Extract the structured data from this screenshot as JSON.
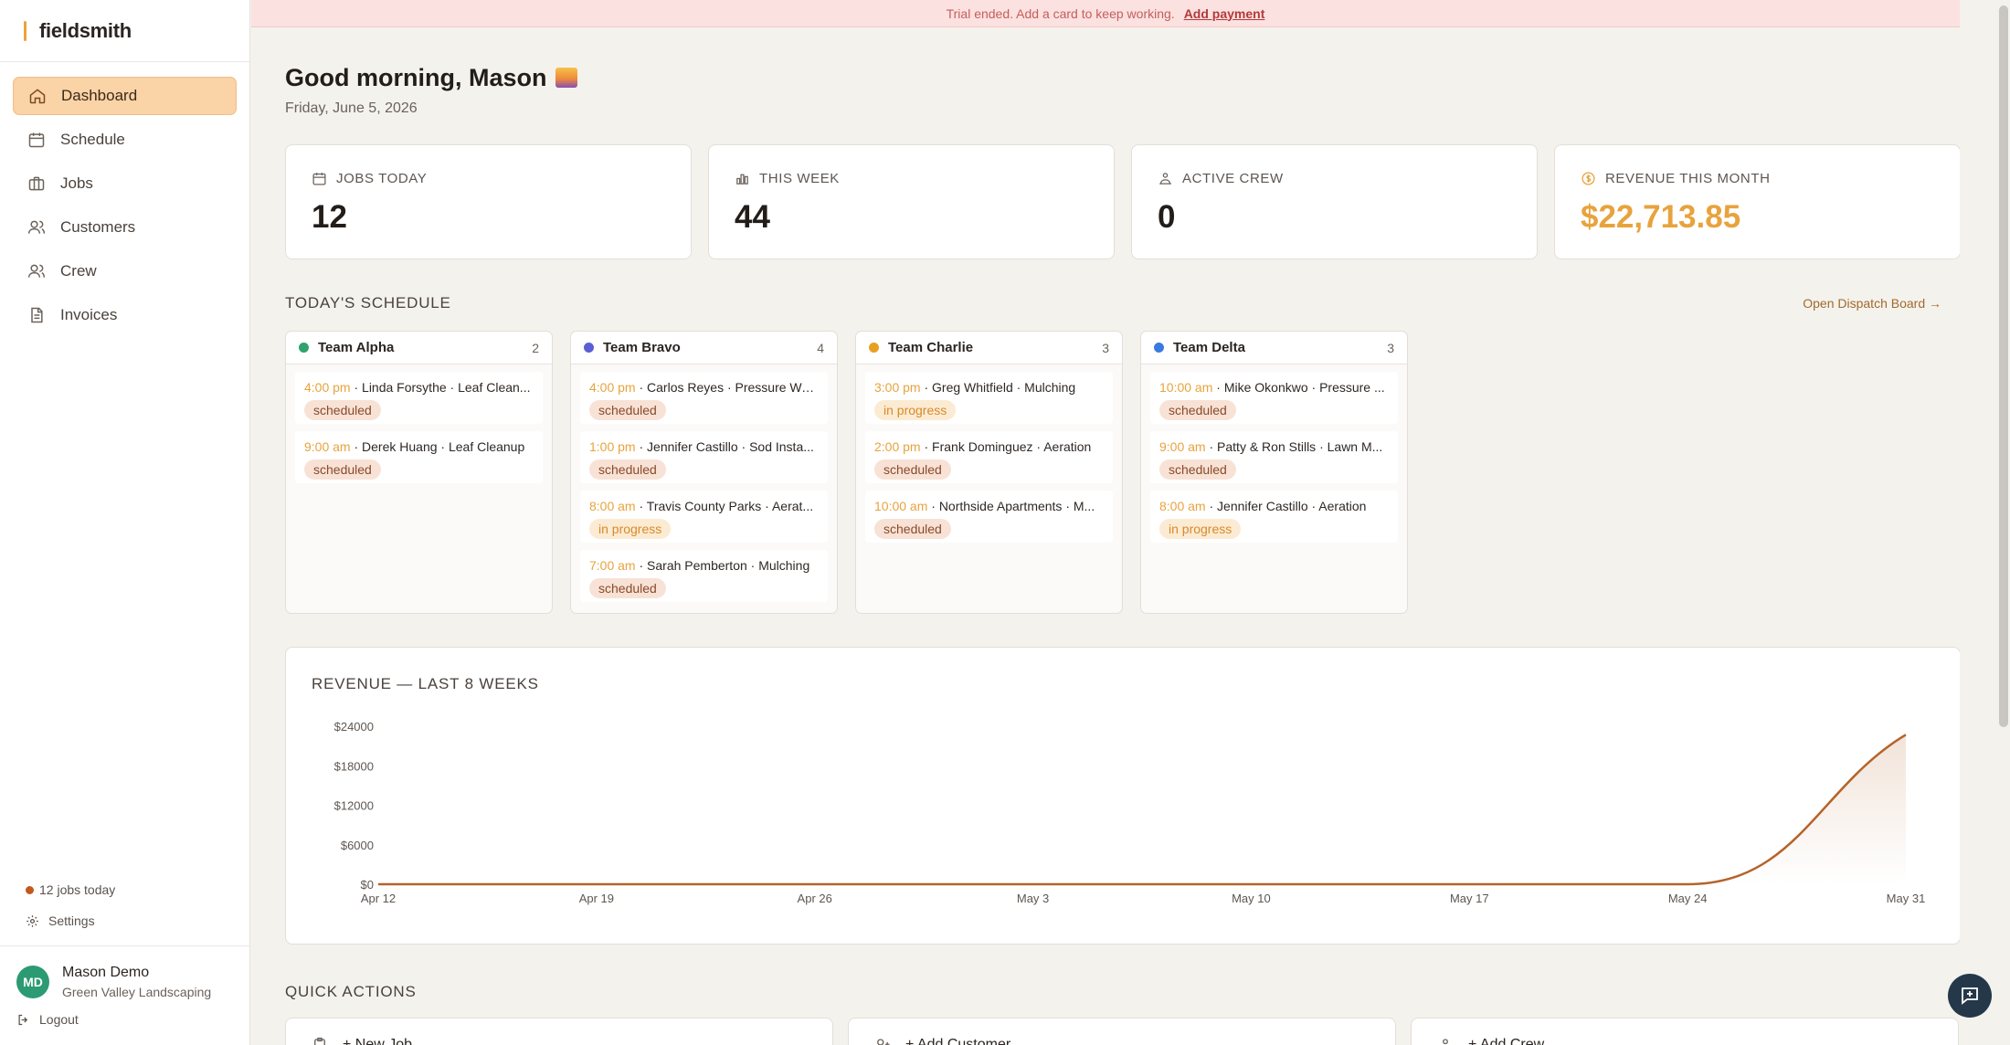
{
  "app": {
    "name": "fieldsmith"
  },
  "banner": {
    "text": "Trial ended. Add a card to keep working.",
    "link": "Add payment"
  },
  "sidebar": {
    "items": [
      {
        "label": "Dashboard",
        "icon": "home-icon",
        "active": true
      },
      {
        "label": "Schedule",
        "icon": "calendar-icon"
      },
      {
        "label": "Jobs",
        "icon": "briefcase-icon"
      },
      {
        "label": "Customers",
        "icon": "users-icon"
      },
      {
        "label": "Crew",
        "icon": "users-icon"
      },
      {
        "label": "Invoices",
        "icon": "document-icon"
      }
    ],
    "status": "12 jobs today",
    "settings": "Settings",
    "user": {
      "initials": "MD",
      "name": "Mason Demo",
      "company": "Green Valley Landscaping"
    },
    "logout": "Logout"
  },
  "header": {
    "greeting": "Good morning, Mason",
    "date": "Friday, June 5, 2026"
  },
  "stats": [
    {
      "label": "JOBS TODAY",
      "value": "12",
      "icon": "calendar-icon"
    },
    {
      "label": "THIS WEEK",
      "value": "44",
      "icon": "bar-chart-icon"
    },
    {
      "label": "ACTIVE CREW",
      "value": "0",
      "icon": "crew-icon"
    },
    {
      "label": "REVENUE THIS MONTH",
      "value": "$22,713.85",
      "icon": "dollar-icon"
    }
  ],
  "schedule": {
    "title": "TODAY'S SCHEDULE",
    "link": "Open Dispatch Board →",
    "teams": [
      {
        "name": "Team Alpha",
        "count": "2",
        "color": "#2fa36b",
        "jobs": [
          {
            "time": "4:00 pm",
            "text": " · Linda Forsythe · Leaf Clean...",
            "status": "scheduled"
          },
          {
            "time": "9:00 am",
            "text": " · Derek Huang · Leaf Cleanup",
            "status": "scheduled"
          }
        ]
      },
      {
        "name": "Team Bravo",
        "count": "4",
        "color": "#5a5fd6",
        "jobs": [
          {
            "time": "4:00 pm",
            "text": " · Carlos Reyes · Pressure Wa...",
            "status": "scheduled"
          },
          {
            "time": "1:00 pm",
            "text": " · Jennifer Castillo · Sod Insta...",
            "status": "scheduled"
          },
          {
            "time": "8:00 am",
            "text": " · Travis County Parks · Aerat...",
            "status": "in progress"
          },
          {
            "time": "7:00 am",
            "text": " · Sarah Pemberton · Mulching",
            "status": "scheduled"
          }
        ]
      },
      {
        "name": "Team Charlie",
        "count": "3",
        "color": "#e8a020",
        "jobs": [
          {
            "time": "3:00 pm",
            "text": " · Greg Whitfield · Mulching",
            "status": "in progress"
          },
          {
            "time": "2:00 pm",
            "text": " · Frank Dominguez · Aeration",
            "status": "scheduled"
          },
          {
            "time": "10:00 am",
            "text": " · Northside Apartments · M...",
            "status": "scheduled"
          }
        ]
      },
      {
        "name": "Team Delta",
        "count": "3",
        "color": "#3a7ae0",
        "jobs": [
          {
            "time": "10:00 am",
            "text": " · Mike Okonkwo · Pressure ...",
            "status": "scheduled"
          },
          {
            "time": "9:00 am",
            "text": " · Patty & Ron Stills · Lawn M...",
            "status": "scheduled"
          },
          {
            "time": "8:00 am",
            "text": " · Jennifer Castillo · Aeration",
            "status": "in progress"
          }
        ]
      }
    ]
  },
  "revenue": {
    "title": "REVENUE — LAST 8 WEEKS",
    "chart_data": {
      "type": "area",
      "x": [
        "Apr 12",
        "Apr 19",
        "Apr 26",
        "May 3",
        "May 10",
        "May 17",
        "May 24",
        "May 31"
      ],
      "values": [
        0,
        0,
        0,
        0,
        0,
        0,
        0,
        22714
      ],
      "ylim": [
        0,
        24000
      ],
      "yticks": [
        "$0",
        "$6000",
        "$12000",
        "$18000",
        "$24000"
      ],
      "ytick_values": [
        0,
        6000,
        12000,
        18000,
        24000
      ],
      "color": "#b5632a",
      "grid": false
    }
  },
  "quick_actions": {
    "title": "QUICK ACTIONS",
    "items": [
      {
        "label": "+ New Job",
        "icon": "clipboard-icon"
      },
      {
        "label": "+ Add Customer",
        "icon": "user-plus-icon"
      },
      {
        "label": "+ Add Crew",
        "icon": "crew-icon"
      }
    ]
  }
}
